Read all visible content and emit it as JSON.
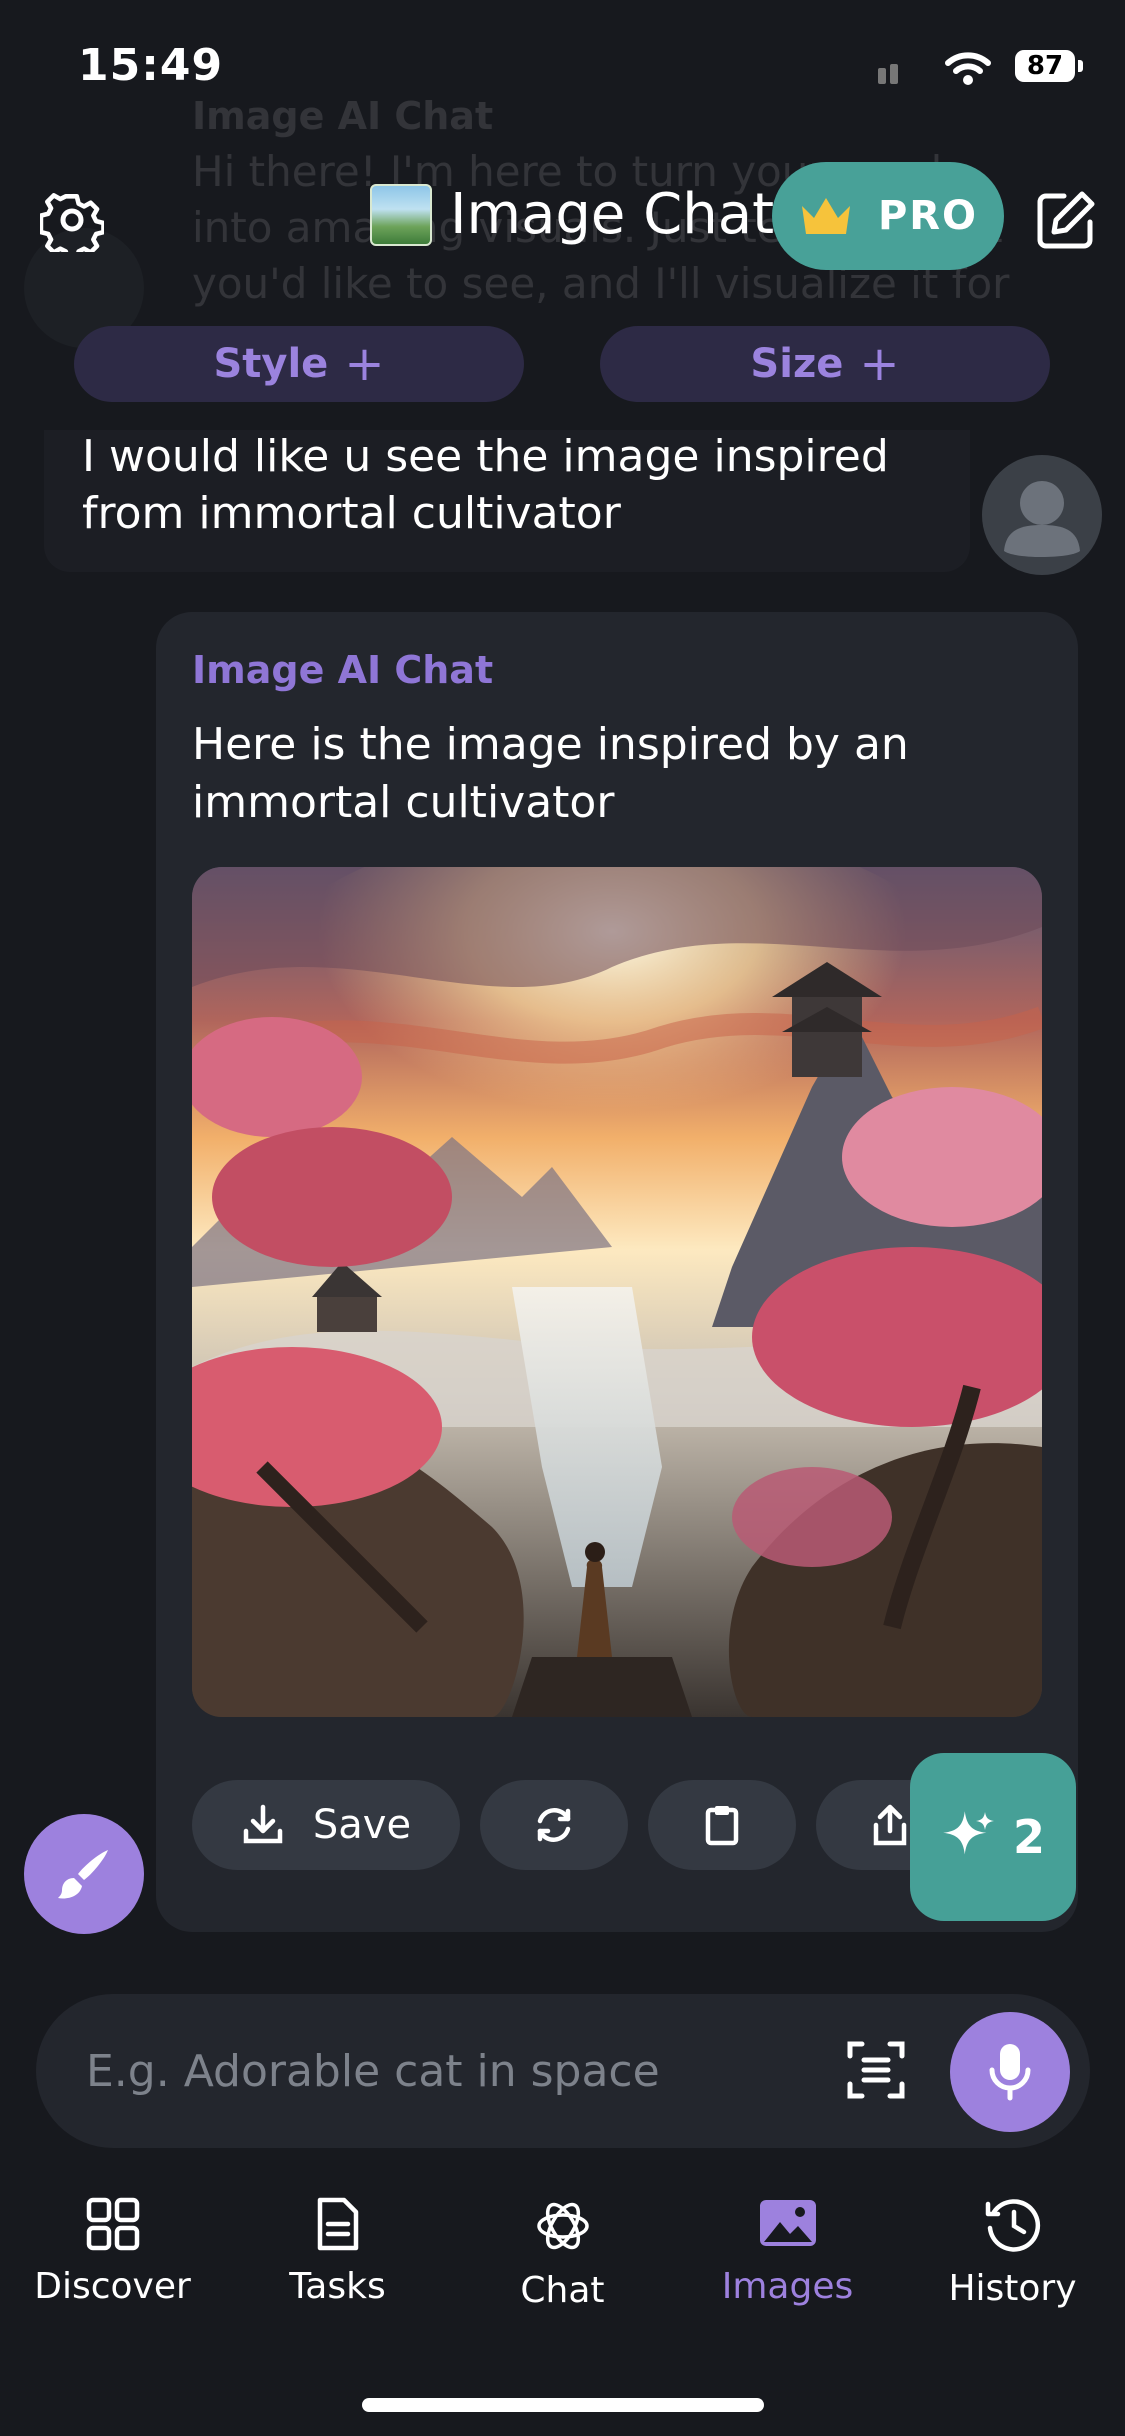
{
  "status": {
    "time": "15:49",
    "battery": "87"
  },
  "ghost": {
    "name": "Image AI Chat",
    "text": "Hi there! I'm here to turn your words into amazing visuals. Just tell me what you'd like to see, and I'll visualize it for you."
  },
  "header": {
    "title": "Image Chat",
    "pro_label": "PRO"
  },
  "chips": {
    "style": "Style",
    "size": "Size"
  },
  "user_message": "I would like u see the image inspired from immortal cultivator",
  "bot": {
    "name": "Image AI Chat",
    "text": "Here is the image inspired by an immortal cultivator",
    "actions": {
      "save": "Save"
    }
  },
  "spark": {
    "count": "2"
  },
  "composer": {
    "placeholder": "E.g. Adorable cat in space"
  },
  "tabs": [
    {
      "label": "Discover",
      "icon": "grid-icon"
    },
    {
      "label": "Tasks",
      "icon": "document-icon"
    },
    {
      "label": "Chat",
      "icon": "chat-knot-icon"
    },
    {
      "label": "Images",
      "icon": "image-icon"
    },
    {
      "label": "History",
      "icon": "clock-history-icon"
    }
  ],
  "active_tab": "Images",
  "colors": {
    "accent": "#9d81de",
    "teal": "#48a198",
    "background": "#17191e",
    "card": "#23262d"
  }
}
